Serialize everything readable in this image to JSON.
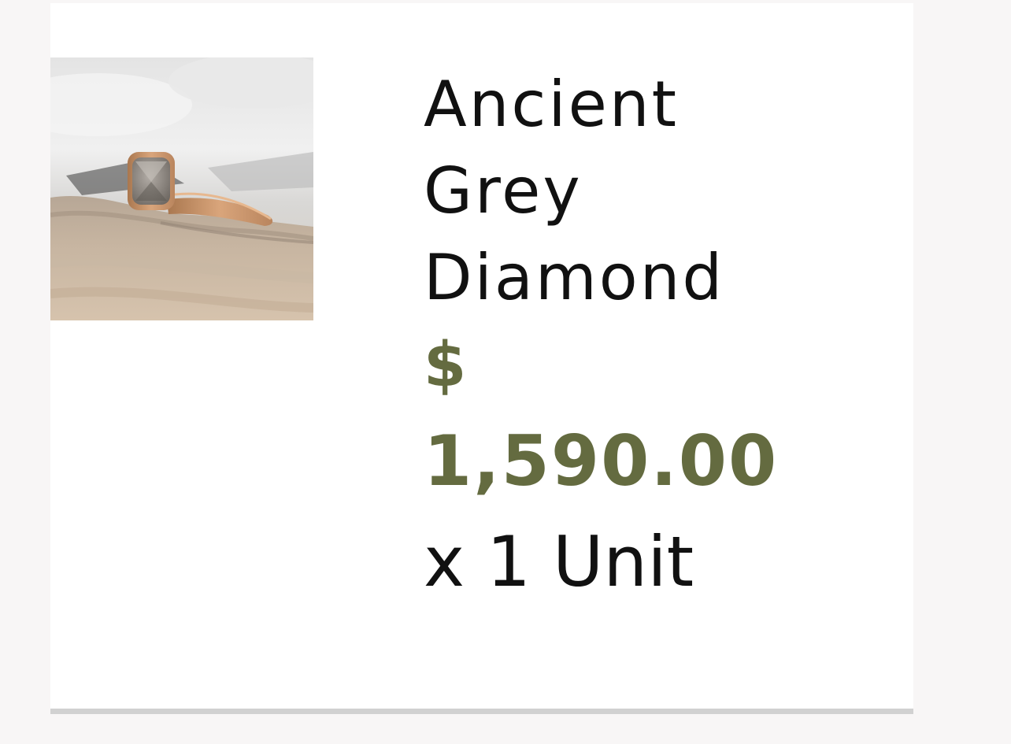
{
  "cart_item": {
    "title_lines": [
      "Ancient",
      "Grey",
      "Diamond"
    ],
    "price_symbol": "$",
    "price_value": "1,590.00",
    "quantity_text": "x 1 Unit",
    "image": {
      "icon": "ring-product-photo",
      "alt": "Ancient Grey Diamond"
    },
    "colors": {
      "price": "#646b40",
      "text": "#111111",
      "background": "#ffffff",
      "divider": "#d1d1d1"
    }
  }
}
